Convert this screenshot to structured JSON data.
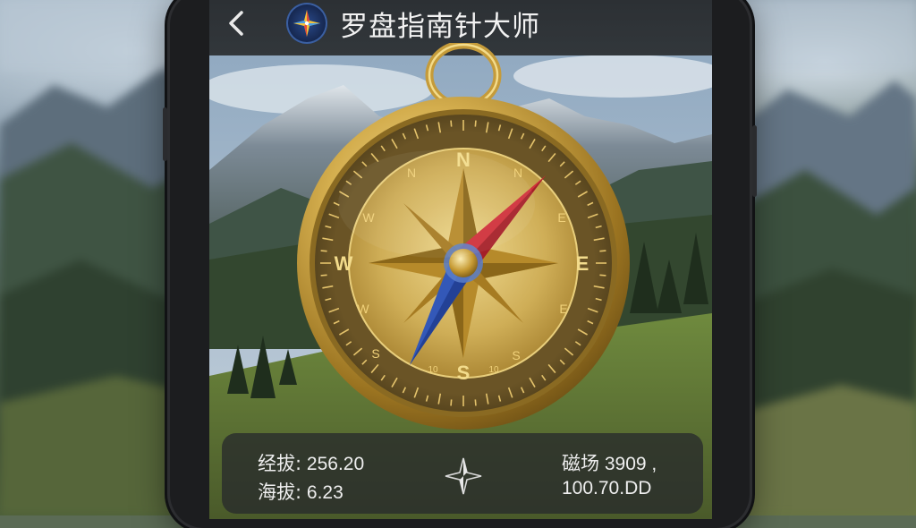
{
  "header": {
    "back_icon": "chevron-left-icon",
    "logo_icon": "compass-star-icon",
    "title": "罗盘指南针大师"
  },
  "compass": {
    "cardinals": [
      "N",
      "E",
      "S",
      "W"
    ],
    "intercardinals": [
      "N",
      "E",
      "E",
      "S",
      "S",
      "W",
      "W",
      "N"
    ],
    "ring_numbers": [
      "10",
      "10"
    ],
    "colors": {
      "gold": "#c9a544",
      "needle_north": "#d0303a",
      "needle_south": "#3358b8"
    }
  },
  "readout": {
    "longitude_label": "经拔:",
    "longitude_value": "256.20",
    "altitude_label": "海拔:",
    "altitude_value": "6.23",
    "magnetic_label": "磁场",
    "magnetic_value": "3909",
    "magnetic_suffix": ",",
    "magnetic_value2": "100.70.DD",
    "center_icon": "compass-rose-icon"
  }
}
